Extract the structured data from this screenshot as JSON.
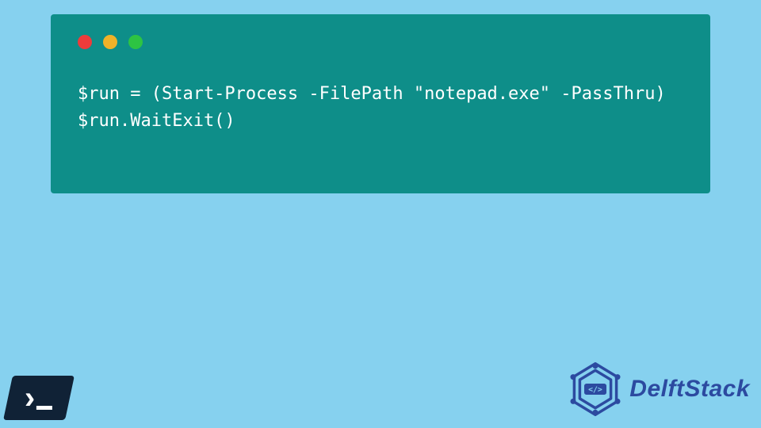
{
  "code": {
    "lines": [
      "$run = (Start-Process -FilePath \"notepad.exe\" -PassThru)",
      "$run.WaitExit()"
    ]
  },
  "brand": {
    "name": "DelftStack"
  },
  "badges": {
    "bottom_left": "powershell-icon"
  },
  "colors": {
    "page_bg": "#86d1ef",
    "window_bg": "#0e8e89",
    "code_fg": "#ffffff",
    "brand_fg": "#2c4aa0"
  }
}
